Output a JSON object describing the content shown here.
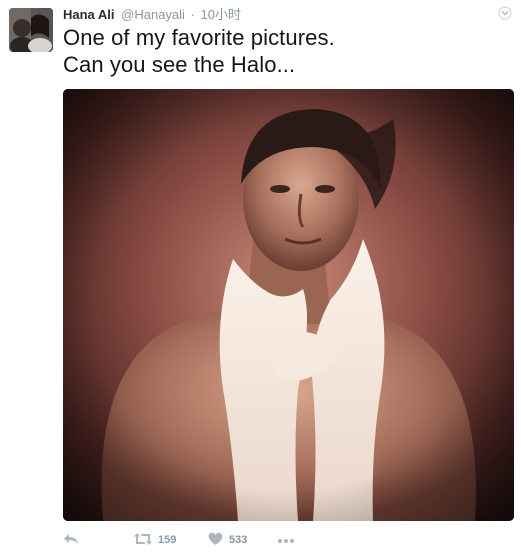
{
  "tweet": {
    "author": {
      "fullname": "Hana Ali",
      "username": "@Hanayali",
      "avatar_icon": "avatar-photo"
    },
    "separator": "·",
    "time": "10小时",
    "text_lines": [
      "One of my favorite pictures.",
      "Can you see the Halo..."
    ],
    "media_icon": "photo-portrait"
  },
  "actions": {
    "reply": {
      "icon": "reply-icon"
    },
    "retweet": {
      "icon": "retweet-icon",
      "count": "159"
    },
    "like": {
      "icon": "heart-icon",
      "count": "533"
    },
    "more": {
      "icon": "more-dots-icon"
    }
  },
  "colors": {
    "text": "#14171a",
    "secondary": "#8899a6",
    "icon": "#aab8c2"
  }
}
